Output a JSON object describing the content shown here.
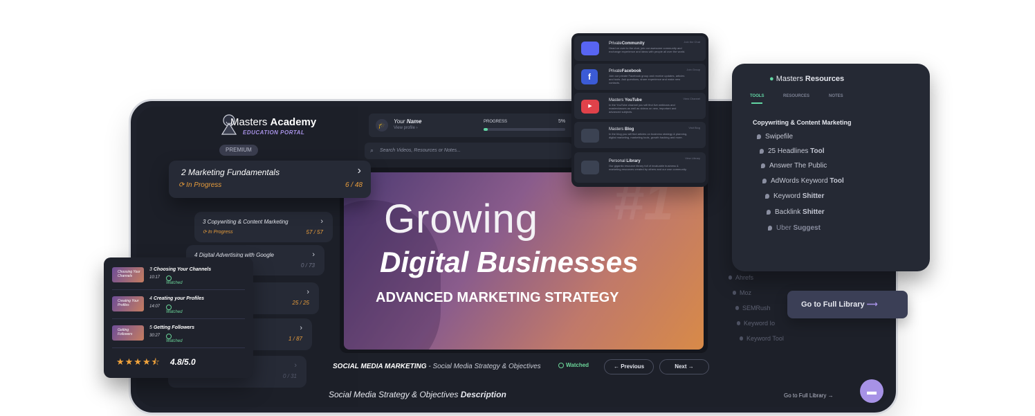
{
  "brand": {
    "title_a": "Masters",
    "title_b": "Academy",
    "subtitle": "EDUCATION PORTAL",
    "badge": "PREMIUM"
  },
  "profile": {
    "name_a": "Your",
    "name_b": "Name",
    "link": "View profile ›",
    "progress_label": "PROGRESS",
    "progress_value": "5%",
    "progress_fraction": 0.05
  },
  "search": {
    "placeholder": "Search Videos, Resources or Notes..."
  },
  "modules": [
    {
      "num": "2",
      "title": "Marketing Fundamentals",
      "status": "In Progress",
      "count": "6 / 48"
    },
    {
      "num": "3",
      "title": "Copywriting & Content Marketing",
      "status": "In Progress",
      "count": "57 / 57"
    },
    {
      "num": "4",
      "title": "Digital Advertising with Google",
      "status": "",
      "count": "0 / 73"
    },
    {
      "title_tail": "g",
      "count": "25 / 25"
    },
    {
      "title_tail": "ing",
      "count": "1 / 87"
    },
    {
      "count": "0 / 31"
    }
  ],
  "lessons": [
    {
      "thumb": "Choosing Your Channels",
      "num": "3",
      "title": "Choosing Your Channels",
      "time": "10:17",
      "status": "Watched"
    },
    {
      "thumb": "Creating Your Profiles",
      "num": "4",
      "title": "Creating your Profiles",
      "time": "14:07",
      "status": "Watched"
    },
    {
      "thumb": "Getting Followers",
      "num": "5",
      "title": "Getting Followers",
      "time": "30:27",
      "status": "Watched"
    }
  ],
  "rating": {
    "text": "4.8/5.0",
    "stars": 4.5
  },
  "video": {
    "line1": "Growing",
    "line2": "Digital Businesses",
    "line3": "ADVANCED MARKETING STRATEGY",
    "deco": "#1"
  },
  "lesson_bar": {
    "category": "SOCIAL MEDIA MARKETING",
    "title": " - Social Media Strategy & Objectives",
    "status": "Watched",
    "prev": "Previous",
    "next": "Next"
  },
  "description": {
    "title_a": "Social Media Strategy & Objectives",
    "title_b": "Description"
  },
  "library_link": "Go to Full Library",
  "community": [
    {
      "pre": "Private",
      "bold": "Community",
      "action": "Join the Chat",
      "desc": "Head on over to the chat, join our awesome community and exchange experience and ideas with people all over the world.",
      "color": "#5865f2",
      "icon": "discord-icon"
    },
    {
      "pre": "Private",
      "bold": "Facebook",
      "action": "Join Group",
      "desc": "Join our private Facebook group and receive updates, articles and tools. Ask questions, share experience and make new contacts.",
      "color": "#3b5bd6",
      "icon": "facebook-icon"
    },
    {
      "pre": "Masters",
      "bold": "YouTube",
      "action": "View Channel",
      "desc": "In the YouTube channel you will find live webinars and masterclasses as well as videos on new, important and advanced subjects.",
      "color": "#e0424a",
      "icon": "youtube-icon"
    },
    {
      "pre": "Masters",
      "bold": "Blog",
      "action": "Visit Blog",
      "desc": "In the blog you will find articles on business strategy & planning, digital marketing, marketing tools, growth hacking and more.",
      "color": "#3b4252",
      "icon": "blog-icon"
    },
    {
      "pre": "Personal",
      "bold": "Library",
      "action": "View Library",
      "desc": "Our gigantic resource library full of invaluable business & marketing resources created by others and our own community.",
      "color": "#3b4252",
      "icon": "library-icon"
    }
  ],
  "resources": {
    "title_a": "Masters",
    "title_b": "Resources",
    "tabs": [
      "TOOLS",
      "RESOURCES",
      "NOTES"
    ],
    "section": "Copywriting & Content Marketing",
    "items": [
      {
        "a": "Swipefile",
        "b": ""
      },
      {
        "a": "25 Headlines",
        "b": "Tool"
      },
      {
        "a": "Answer The Public",
        "b": ""
      },
      {
        "a": "AdWords Keyword",
        "b": "Tool"
      },
      {
        "a": "Keyword",
        "b": "Shitter"
      },
      {
        "a": "Backlink",
        "b": "Shitter"
      },
      {
        "a": "Uber",
        "b": "Suggest"
      }
    ],
    "button": "Go to Full Library"
  },
  "ghost_list": [
    "Ahrefs",
    "Moz",
    "SEMRush",
    "Keyword Io",
    "Keyword Tool"
  ],
  "colors": {
    "accent": "#a792e6",
    "orange": "#e89d3c",
    "green": "#6cd69a",
    "bg": "#1d2029"
  }
}
